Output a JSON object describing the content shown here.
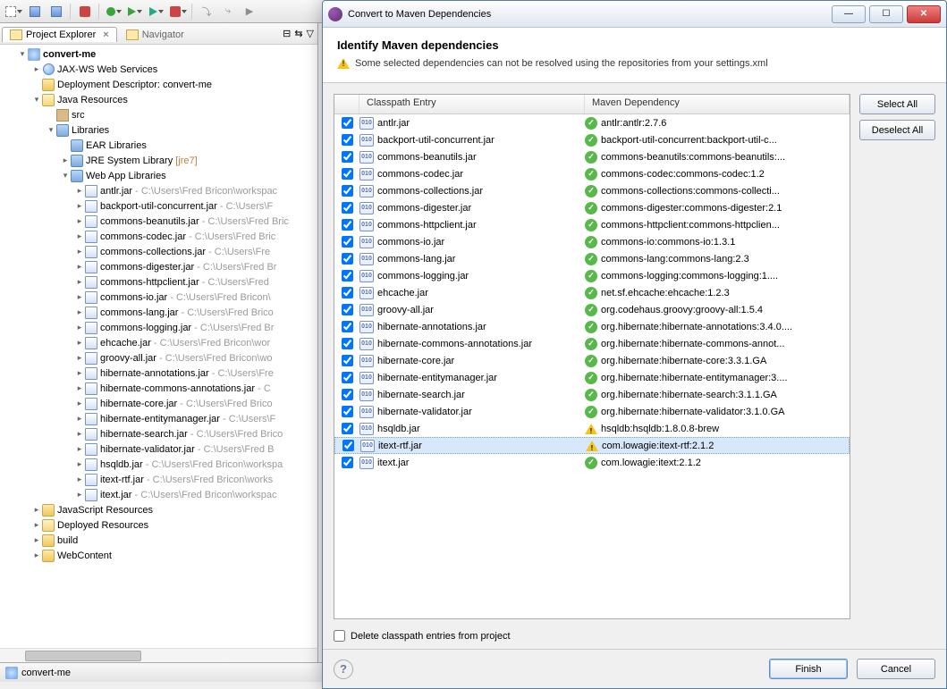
{
  "explorer": {
    "title": "Project Explorer",
    "navigator": "Navigator",
    "project": "convert-me",
    "nodes": {
      "jaxws": "JAX-WS Web Services",
      "deploy": "Deployment Descriptor: convert-me",
      "javares": "Java Resources",
      "src": "src",
      "libraries": "Libraries",
      "ear": "EAR Libraries",
      "jre_label": "JRE System Library",
      "jre_dec": " [jre7]",
      "webapp": "Web App Libraries",
      "jsres": "JavaScript Resources",
      "depres": "Deployed Resources",
      "build": "build",
      "webcontent": "WebContent"
    },
    "jars": [
      {
        "name": "antlr.jar",
        "path": " - C:\\Users\\Fred Bricon\\workspac"
      },
      {
        "name": "backport-util-concurrent.jar",
        "path": " - C:\\Users\\F"
      },
      {
        "name": "commons-beanutils.jar",
        "path": " - C:\\Users\\Fred Bric"
      },
      {
        "name": "commons-codec.jar",
        "path": " - C:\\Users\\Fred Bric"
      },
      {
        "name": "commons-collections.jar",
        "path": " - C:\\Users\\Fre"
      },
      {
        "name": "commons-digester.jar",
        "path": " - C:\\Users\\Fred Br"
      },
      {
        "name": "commons-httpclient.jar",
        "path": " - C:\\Users\\Fred "
      },
      {
        "name": "commons-io.jar",
        "path": " - C:\\Users\\Fred Bricon\\"
      },
      {
        "name": "commons-lang.jar",
        "path": " - C:\\Users\\Fred Brico"
      },
      {
        "name": "commons-logging.jar",
        "path": " - C:\\Users\\Fred Br"
      },
      {
        "name": "ehcache.jar",
        "path": " - C:\\Users\\Fred Bricon\\wor"
      },
      {
        "name": "groovy-all.jar",
        "path": " - C:\\Users\\Fred Bricon\\wo"
      },
      {
        "name": "hibernate-annotations.jar",
        "path": " - C:\\Users\\Fre"
      },
      {
        "name": "hibernate-commons-annotations.jar",
        "path": " - C"
      },
      {
        "name": "hibernate-core.jar",
        "path": " - C:\\Users\\Fred Brico"
      },
      {
        "name": "hibernate-entitymanager.jar",
        "path": " - C:\\Users\\F"
      },
      {
        "name": "hibernate-search.jar",
        "path": " - C:\\Users\\Fred Brico"
      },
      {
        "name": "hibernate-validator.jar",
        "path": " - C:\\Users\\Fred B"
      },
      {
        "name": "hsqldb.jar",
        "path": " - C:\\Users\\Fred Bricon\\workspa"
      },
      {
        "name": "itext-rtf.jar",
        "path": " - C:\\Users\\Fred Bricon\\works"
      },
      {
        "name": "itext.jar",
        "path": " - C:\\Users\\Fred Bricon\\workspac"
      }
    ]
  },
  "statusbar": {
    "text": "convert-me"
  },
  "dialog": {
    "title": "Convert to Maven Dependencies",
    "header": "Identify Maven dependencies",
    "warning": "Some selected dependencies can not be resolved using the repositories from your settings.xml",
    "columns": {
      "c1": "Classpath Entry",
      "c2": "Maven Dependency"
    },
    "select_all": "Select All",
    "deselect_all": "Deselect All",
    "delete_entries": "Delete classpath entries from project",
    "finish": "Finish",
    "cancel": "Cancel",
    "rows": [
      {
        "entry": "antlr.jar",
        "dep": "antlr:antlr:2.7.6",
        "status": "ok"
      },
      {
        "entry": "backport-util-concurrent.jar",
        "dep": "backport-util-concurrent:backport-util-c...",
        "status": "ok"
      },
      {
        "entry": "commons-beanutils.jar",
        "dep": "commons-beanutils:commons-beanutils:...",
        "status": "ok"
      },
      {
        "entry": "commons-codec.jar",
        "dep": "commons-codec:commons-codec:1.2",
        "status": "ok"
      },
      {
        "entry": "commons-collections.jar",
        "dep": "commons-collections:commons-collecti...",
        "status": "ok"
      },
      {
        "entry": "commons-digester.jar",
        "dep": "commons-digester:commons-digester:2.1",
        "status": "ok"
      },
      {
        "entry": "commons-httpclient.jar",
        "dep": "commons-httpclient:commons-httpclien...",
        "status": "ok"
      },
      {
        "entry": "commons-io.jar",
        "dep": "commons-io:commons-io:1.3.1",
        "status": "ok"
      },
      {
        "entry": "commons-lang.jar",
        "dep": "commons-lang:commons-lang:2.3",
        "status": "ok"
      },
      {
        "entry": "commons-logging.jar",
        "dep": "commons-logging:commons-logging:1....",
        "status": "ok"
      },
      {
        "entry": "ehcache.jar",
        "dep": "net.sf.ehcache:ehcache:1.2.3",
        "status": "ok"
      },
      {
        "entry": "groovy-all.jar",
        "dep": "org.codehaus.groovy:groovy-all:1.5.4",
        "status": "ok"
      },
      {
        "entry": "hibernate-annotations.jar",
        "dep": "org.hibernate:hibernate-annotations:3.4.0....",
        "status": "ok"
      },
      {
        "entry": "hibernate-commons-annotations.jar",
        "dep": "org.hibernate:hibernate-commons-annot...",
        "status": "ok"
      },
      {
        "entry": "hibernate-core.jar",
        "dep": "org.hibernate:hibernate-core:3.3.1.GA",
        "status": "ok"
      },
      {
        "entry": "hibernate-entitymanager.jar",
        "dep": "org.hibernate:hibernate-entitymanager:3....",
        "status": "ok"
      },
      {
        "entry": "hibernate-search.jar",
        "dep": "org.hibernate:hibernate-search:3.1.1.GA",
        "status": "ok"
      },
      {
        "entry": "hibernate-validator.jar",
        "dep": "org.hibernate:hibernate-validator:3.1.0.GA",
        "status": "ok"
      },
      {
        "entry": "hsqldb.jar",
        "dep": "hsqldb:hsqldb:1.8.0.8-brew",
        "status": "warn"
      },
      {
        "entry": "itext-rtf.jar",
        "dep": "com.lowagie:itext-rtf:2.1.2",
        "status": "warn",
        "selected": true
      },
      {
        "entry": "itext.jar",
        "dep": "com.lowagie:itext:2.1.2",
        "status": "ok"
      }
    ]
  }
}
